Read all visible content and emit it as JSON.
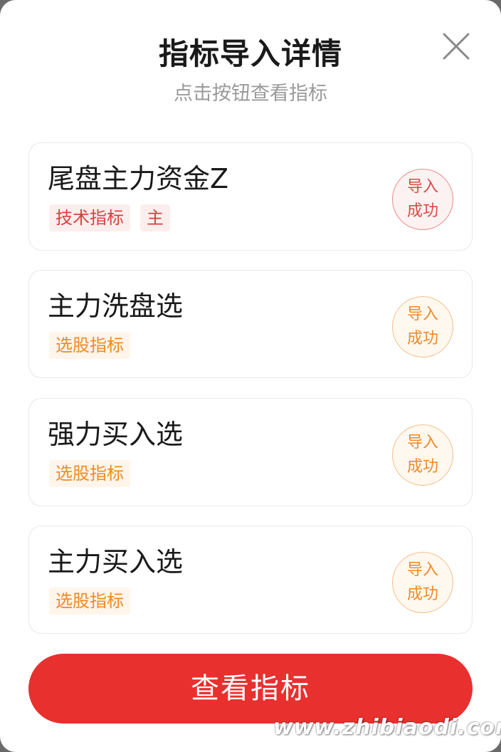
{
  "modal": {
    "title": "指标导入详情",
    "subtitle": "点击按钮查看指标",
    "close_icon": "close-x-icon"
  },
  "items": [
    {
      "name": "尾盘主力资金Z",
      "tags": [
        "技术指标",
        "主"
      ],
      "tag_color": "#d94040",
      "status_line1": "导入",
      "status_line2": "成功",
      "status_color": "red"
    },
    {
      "name": "主力洗盘选",
      "tags": [
        "选股指标"
      ],
      "tag_color": "#f08a24",
      "status_line1": "导入",
      "status_line2": "成功",
      "status_color": "orange"
    },
    {
      "name": "强力买入选",
      "tags": [
        "选股指标"
      ],
      "tag_color": "#f08a24",
      "status_line1": "导入",
      "status_line2": "成功",
      "status_color": "orange"
    },
    {
      "name": "主力买入选",
      "tags": [
        "选股指标"
      ],
      "tag_color": "#f08a24",
      "status_line1": "导入",
      "status_line2": "成功",
      "status_color": "orange"
    }
  ],
  "button": {
    "label": "查看指标",
    "color": "#e8302f"
  },
  "watermark": "www.zhibiaodi.com"
}
